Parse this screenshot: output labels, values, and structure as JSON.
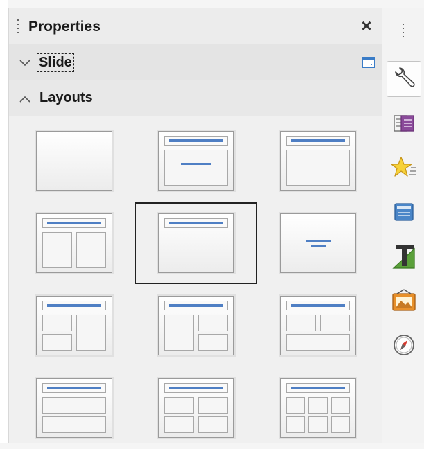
{
  "panel": {
    "title": "Properties",
    "close_glyph": "×",
    "close_icon": "close-icon"
  },
  "slide_section": {
    "label": "Slide",
    "expanded": false,
    "chevron_icon": "chevron-down-icon",
    "more_options_icon": "more-options-icon"
  },
  "layouts_section": {
    "label": "Layouts",
    "expanded": true,
    "chevron_icon": "chevron-up-icon",
    "selected_layout": "title-content",
    "layouts": [
      {
        "id": "blank",
        "icon": "layout-blank-icon"
      },
      {
        "id": "title-slide",
        "icon": "layout-title-slide-icon"
      },
      {
        "id": "title-content",
        "icon": "layout-title-content-icon"
      },
      {
        "id": "title-2-content",
        "icon": "layout-title-2-content-icon"
      },
      {
        "id": "title-only",
        "icon": "layout-title-only-icon",
        "selected": true
      },
      {
        "id": "centered-text",
        "icon": "layout-centered-text-icon"
      },
      {
        "id": "title-2-content-and-content",
        "icon": "layout-title-2content-content-icon"
      },
      {
        "id": "title-content-and-2-content",
        "icon": "layout-title-content-2content-icon"
      },
      {
        "id": "title-2-content-over-content",
        "icon": "layout-title-2content-over-content-icon"
      },
      {
        "id": "title-content-over-content",
        "icon": "layout-title-content-over-content-icon"
      },
      {
        "id": "title-4-content",
        "icon": "layout-title-4-content-icon"
      },
      {
        "id": "title-6-content",
        "icon": "layout-title-6-content-icon"
      }
    ]
  },
  "sidebar_tabs": [
    {
      "id": "properties",
      "icon": "wrench-icon",
      "active": true
    },
    {
      "id": "slide-transition",
      "icon": "slide-transition-icon"
    },
    {
      "id": "animation",
      "icon": "star-icon"
    },
    {
      "id": "master-slides",
      "icon": "master-slides-icon"
    },
    {
      "id": "styles",
      "icon": "styles-icon"
    },
    {
      "id": "gallery",
      "icon": "gallery-icon"
    },
    {
      "id": "navigator",
      "icon": "compass-icon"
    }
  ],
  "colors": {
    "accent": "#4f7fc4",
    "panel_bg": "#f0f0f0",
    "header_bg": "#e4e4e4"
  }
}
